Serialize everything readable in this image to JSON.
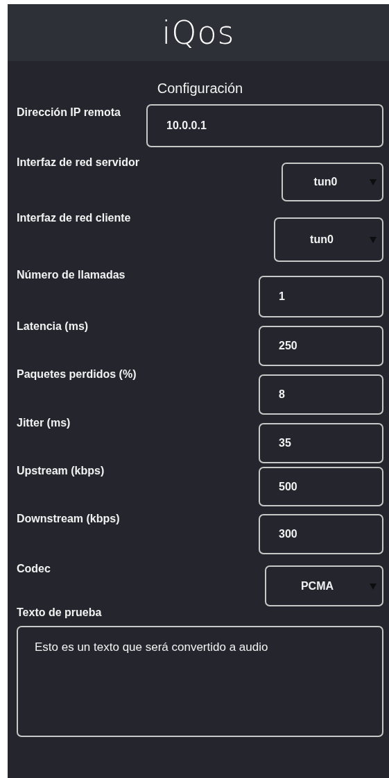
{
  "header": {
    "logo": "iQos"
  },
  "title": "Configuración",
  "fields": [
    {
      "label": "Dirección IP remota",
      "kind": "text",
      "value": "10.0.0.1"
    },
    {
      "label": "Interfaz de red servidor",
      "kind": "select",
      "value": "tun0"
    },
    {
      "label": "Interfaz de red cliente",
      "kind": "select",
      "value": "tun0"
    },
    {
      "label": "Número de llamadas",
      "kind": "text",
      "value": "1"
    },
    {
      "label": "Latencia (ms)",
      "kind": "text",
      "value": "250"
    },
    {
      "label": "Paquetes perdidos (%)",
      "kind": "text",
      "value": "8"
    },
    {
      "label": "Jitter (ms)",
      "kind": "text",
      "value": "35"
    },
    {
      "label": "Upstream (kbps)",
      "kind": "text",
      "value": "500"
    },
    {
      "label": "Downstream (kbps)",
      "kind": "text",
      "value": "300"
    },
    {
      "label": "Codec",
      "kind": "select",
      "value": "PCMA"
    }
  ],
  "test_text": {
    "label": "Texto de prueba",
    "value": "Esto es un texto que será convertido a audio"
  }
}
